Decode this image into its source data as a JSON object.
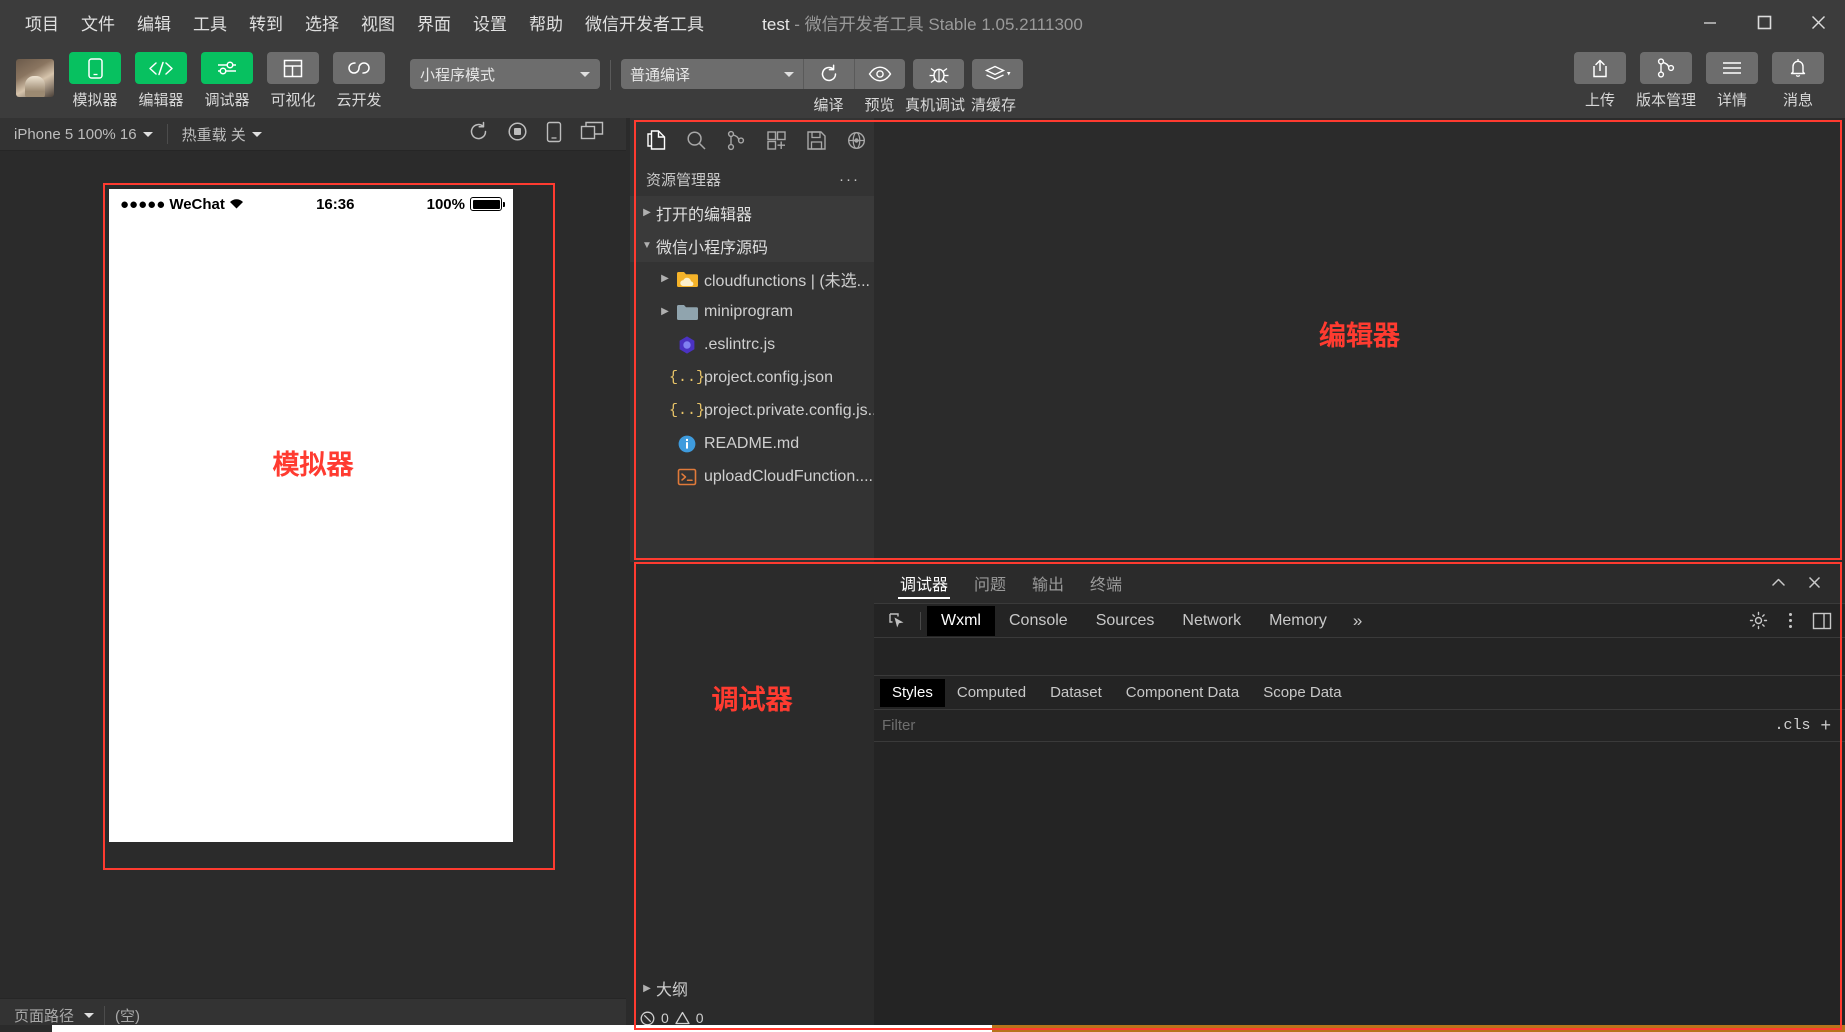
{
  "window": {
    "title_project": "test",
    "title_rest": " -  微信开发者工具 Stable 1.05.2111300",
    "minimize": "—",
    "maximize": "☐",
    "close": "✕"
  },
  "menubar": {
    "items": [
      {
        "label": "项目",
        "name": "menu-project"
      },
      {
        "label": "文件",
        "name": "menu-file"
      },
      {
        "label": "编辑",
        "name": "menu-edit"
      },
      {
        "label": "工具",
        "name": "menu-tools"
      },
      {
        "label": "转到",
        "name": "menu-goto"
      },
      {
        "label": "选择",
        "name": "menu-select"
      },
      {
        "label": "视图",
        "name": "menu-view"
      },
      {
        "label": "界面",
        "name": "menu-ui"
      },
      {
        "label": "设置",
        "name": "menu-settings"
      },
      {
        "label": "帮助",
        "name": "menu-help"
      },
      {
        "label": "微信开发者工具",
        "name": "menu-devtools"
      }
    ]
  },
  "toolbar": {
    "panel_buttons": [
      {
        "label": "模拟器",
        "icon": "phone-icon",
        "style": "green"
      },
      {
        "label": "编辑器",
        "icon": "code-icon",
        "style": "green"
      },
      {
        "label": "调试器",
        "icon": "sliders-icon",
        "style": "green"
      },
      {
        "label": "可视化",
        "icon": "layout-icon",
        "style": "gray"
      },
      {
        "label": "云开发",
        "icon": "cloud-icon",
        "style": "gray"
      }
    ],
    "mode_select": "小程序模式",
    "compile_select": "普通编译",
    "compile_label": "编译",
    "preview_label": "预览",
    "realdevice_label": "真机调试",
    "clearcache_label": "清缓存",
    "right_buttons": [
      {
        "label": "上传",
        "icon": "upload-icon"
      },
      {
        "label": "版本管理",
        "icon": "branch-icon"
      },
      {
        "label": "详情",
        "icon": "hamburger-icon"
      },
      {
        "label": "消息",
        "icon": "bell-icon"
      }
    ]
  },
  "simulator": {
    "device": "iPhone 5 100% 16",
    "hotreload": "热重载 关",
    "label": "模拟器",
    "toolbar_icons": [
      "refresh-icon",
      "stop-icon",
      "device-icon",
      "multiscreen-icon"
    ],
    "phone": {
      "carrier_dots": "●●●●●",
      "carrier": "WeChat",
      "wifi": "wifi-icon",
      "time": "16:36",
      "battery_text": "100%"
    },
    "status": {
      "page_path": "页面路径",
      "value": "(空)"
    }
  },
  "editor": {
    "label": "编辑器",
    "activity_icons": [
      {
        "name": "files-icon",
        "active": true
      },
      {
        "name": "search-icon",
        "active": false
      },
      {
        "name": "source-control-icon",
        "active": false
      },
      {
        "name": "extensions-icon",
        "active": false
      },
      {
        "name": "save-all-icon",
        "active": false
      },
      {
        "name": "cloud-debug-icon",
        "active": false
      }
    ],
    "explorer_title": "资源管理器",
    "explorer_more": "···",
    "sections": [
      {
        "label": "打开的编辑器",
        "expanded": false
      },
      {
        "label": "微信小程序源码",
        "expanded": true
      }
    ],
    "files": [
      {
        "label": "cloudfunctions | (未选...",
        "icon": "cloud-folder-icon",
        "type": "folder-cloud",
        "arrow": true
      },
      {
        "label": "miniprogram",
        "icon": "folder-icon",
        "type": "folder",
        "arrow": true
      },
      {
        "label": ".eslintrc.js",
        "icon": "eslint-icon",
        "type": "eslint",
        "arrow": false
      },
      {
        "label": "project.config.json",
        "icon": "json-icon",
        "type": "json",
        "arrow": false
      },
      {
        "label": "project.private.config.js...",
        "icon": "json-icon",
        "type": "json",
        "arrow": false
      },
      {
        "label": "README.md",
        "icon": "info-icon",
        "type": "markdown",
        "arrow": false
      },
      {
        "label": "uploadCloudFunction....",
        "icon": "terminal-icon",
        "type": "script",
        "arrow": false
      }
    ]
  },
  "debugger": {
    "label": "调试器",
    "outline_label": "大纲",
    "problems": {
      "errors": "0",
      "warnings": "0"
    },
    "tabs": [
      {
        "label": "调试器",
        "active": true
      },
      {
        "label": "问题",
        "active": false
      },
      {
        "label": "输出",
        "active": false
      },
      {
        "label": "终端",
        "active": false
      }
    ],
    "tabs_right": [
      "chevron-up-icon",
      "close-icon"
    ],
    "devtools": {
      "inspect_icon": "inspect-icon",
      "tabs": [
        {
          "label": "Wxml",
          "active": true
        },
        {
          "label": "Console",
          "active": false
        },
        {
          "label": "Sources",
          "active": false
        },
        {
          "label": "Network",
          "active": false
        },
        {
          "label": "Memory",
          "active": false
        }
      ],
      "more": "»",
      "right_icons": [
        "gear-icon",
        "kebab-icon",
        "dock-icon"
      ],
      "sub_tabs": [
        {
          "label": "Styles",
          "active": true
        },
        {
          "label": "Computed",
          "active": false
        },
        {
          "label": "Dataset",
          "active": false
        },
        {
          "label": "Component Data",
          "active": false
        },
        {
          "label": "Scope Data",
          "active": false
        }
      ],
      "filter_placeholder": "Filter",
      "filter_value": "",
      "cls_label": ".cls",
      "plus_label": "+"
    }
  },
  "colors": {
    "accent_green": "#07c160",
    "annotation_red": "#ff3b30",
    "chrome_bg": "#3c3c3c",
    "panel_bg": "#2b2b2b",
    "devtools_bg": "#242424"
  }
}
